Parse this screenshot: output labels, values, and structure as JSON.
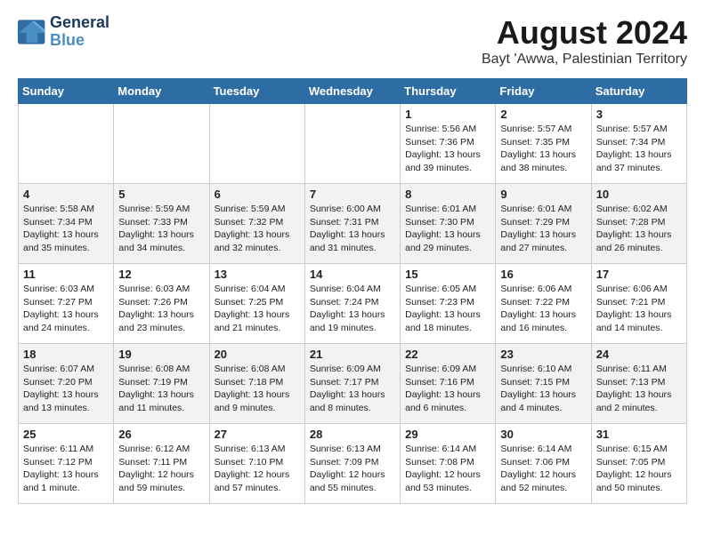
{
  "logo": {
    "line1": "General",
    "line2": "Blue"
  },
  "title": "August 2024",
  "subtitle": "Bayt 'Awwa, Palestinian Territory",
  "days_of_week": [
    "Sunday",
    "Monday",
    "Tuesday",
    "Wednesday",
    "Thursday",
    "Friday",
    "Saturday"
  ],
  "weeks": [
    [
      {
        "day": "",
        "content": ""
      },
      {
        "day": "",
        "content": ""
      },
      {
        "day": "",
        "content": ""
      },
      {
        "day": "",
        "content": ""
      },
      {
        "day": "1",
        "content": "Sunrise: 5:56 AM\nSunset: 7:36 PM\nDaylight: 13 hours and 39 minutes."
      },
      {
        "day": "2",
        "content": "Sunrise: 5:57 AM\nSunset: 7:35 PM\nDaylight: 13 hours and 38 minutes."
      },
      {
        "day": "3",
        "content": "Sunrise: 5:57 AM\nSunset: 7:34 PM\nDaylight: 13 hours and 37 minutes."
      }
    ],
    [
      {
        "day": "4",
        "content": "Sunrise: 5:58 AM\nSunset: 7:34 PM\nDaylight: 13 hours and 35 minutes."
      },
      {
        "day": "5",
        "content": "Sunrise: 5:59 AM\nSunset: 7:33 PM\nDaylight: 13 hours and 34 minutes."
      },
      {
        "day": "6",
        "content": "Sunrise: 5:59 AM\nSunset: 7:32 PM\nDaylight: 13 hours and 32 minutes."
      },
      {
        "day": "7",
        "content": "Sunrise: 6:00 AM\nSunset: 7:31 PM\nDaylight: 13 hours and 31 minutes."
      },
      {
        "day": "8",
        "content": "Sunrise: 6:01 AM\nSunset: 7:30 PM\nDaylight: 13 hours and 29 minutes."
      },
      {
        "day": "9",
        "content": "Sunrise: 6:01 AM\nSunset: 7:29 PM\nDaylight: 13 hours and 27 minutes."
      },
      {
        "day": "10",
        "content": "Sunrise: 6:02 AM\nSunset: 7:28 PM\nDaylight: 13 hours and 26 minutes."
      }
    ],
    [
      {
        "day": "11",
        "content": "Sunrise: 6:03 AM\nSunset: 7:27 PM\nDaylight: 13 hours and 24 minutes."
      },
      {
        "day": "12",
        "content": "Sunrise: 6:03 AM\nSunset: 7:26 PM\nDaylight: 13 hours and 23 minutes."
      },
      {
        "day": "13",
        "content": "Sunrise: 6:04 AM\nSunset: 7:25 PM\nDaylight: 13 hours and 21 minutes."
      },
      {
        "day": "14",
        "content": "Sunrise: 6:04 AM\nSunset: 7:24 PM\nDaylight: 13 hours and 19 minutes."
      },
      {
        "day": "15",
        "content": "Sunrise: 6:05 AM\nSunset: 7:23 PM\nDaylight: 13 hours and 18 minutes."
      },
      {
        "day": "16",
        "content": "Sunrise: 6:06 AM\nSunset: 7:22 PM\nDaylight: 13 hours and 16 minutes."
      },
      {
        "day": "17",
        "content": "Sunrise: 6:06 AM\nSunset: 7:21 PM\nDaylight: 13 hours and 14 minutes."
      }
    ],
    [
      {
        "day": "18",
        "content": "Sunrise: 6:07 AM\nSunset: 7:20 PM\nDaylight: 13 hours and 13 minutes."
      },
      {
        "day": "19",
        "content": "Sunrise: 6:08 AM\nSunset: 7:19 PM\nDaylight: 13 hours and 11 minutes."
      },
      {
        "day": "20",
        "content": "Sunrise: 6:08 AM\nSunset: 7:18 PM\nDaylight: 13 hours and 9 minutes."
      },
      {
        "day": "21",
        "content": "Sunrise: 6:09 AM\nSunset: 7:17 PM\nDaylight: 13 hours and 8 minutes."
      },
      {
        "day": "22",
        "content": "Sunrise: 6:09 AM\nSunset: 7:16 PM\nDaylight: 13 hours and 6 minutes."
      },
      {
        "day": "23",
        "content": "Sunrise: 6:10 AM\nSunset: 7:15 PM\nDaylight: 13 hours and 4 minutes."
      },
      {
        "day": "24",
        "content": "Sunrise: 6:11 AM\nSunset: 7:13 PM\nDaylight: 13 hours and 2 minutes."
      }
    ],
    [
      {
        "day": "25",
        "content": "Sunrise: 6:11 AM\nSunset: 7:12 PM\nDaylight: 13 hours and 1 minute."
      },
      {
        "day": "26",
        "content": "Sunrise: 6:12 AM\nSunset: 7:11 PM\nDaylight: 12 hours and 59 minutes."
      },
      {
        "day": "27",
        "content": "Sunrise: 6:13 AM\nSunset: 7:10 PM\nDaylight: 12 hours and 57 minutes."
      },
      {
        "day": "28",
        "content": "Sunrise: 6:13 AM\nSunset: 7:09 PM\nDaylight: 12 hours and 55 minutes."
      },
      {
        "day": "29",
        "content": "Sunrise: 6:14 AM\nSunset: 7:08 PM\nDaylight: 12 hours and 53 minutes."
      },
      {
        "day": "30",
        "content": "Sunrise: 6:14 AM\nSunset: 7:06 PM\nDaylight: 12 hours and 52 minutes."
      },
      {
        "day": "31",
        "content": "Sunrise: 6:15 AM\nSunset: 7:05 PM\nDaylight: 12 hours and 50 minutes."
      }
    ]
  ]
}
